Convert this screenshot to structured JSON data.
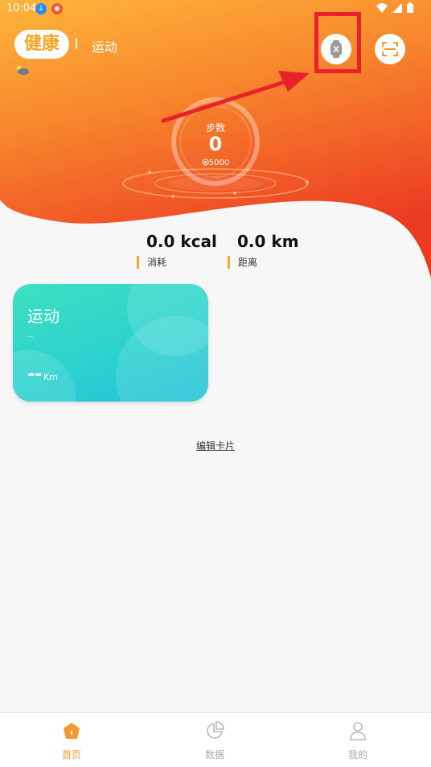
{
  "status_bar": {
    "time": "10:04"
  },
  "header": {
    "brand": "健康",
    "subtitle": "运动"
  },
  "steps": {
    "label": "步数",
    "value": "0",
    "goal": "5000"
  },
  "stats": [
    {
      "value": "0.0  kcal",
      "label": "消耗"
    },
    {
      "value": "0.0  km",
      "label": "距离"
    }
  ],
  "card": {
    "title": "运动",
    "subtitle": "--",
    "value": "--",
    "unit": "Km"
  },
  "edit_card_label": "编辑卡片",
  "nav": [
    {
      "label": "首页",
      "active": true
    },
    {
      "label": "数据",
      "active": false
    },
    {
      "label": "我的",
      "active": false
    }
  ],
  "colors": {
    "accent": "#f5a623",
    "gradient_top": "#fdb53a",
    "gradient_bottom": "#ee3d21",
    "card": "#2cd2cf",
    "highlight": "#e8222a"
  }
}
